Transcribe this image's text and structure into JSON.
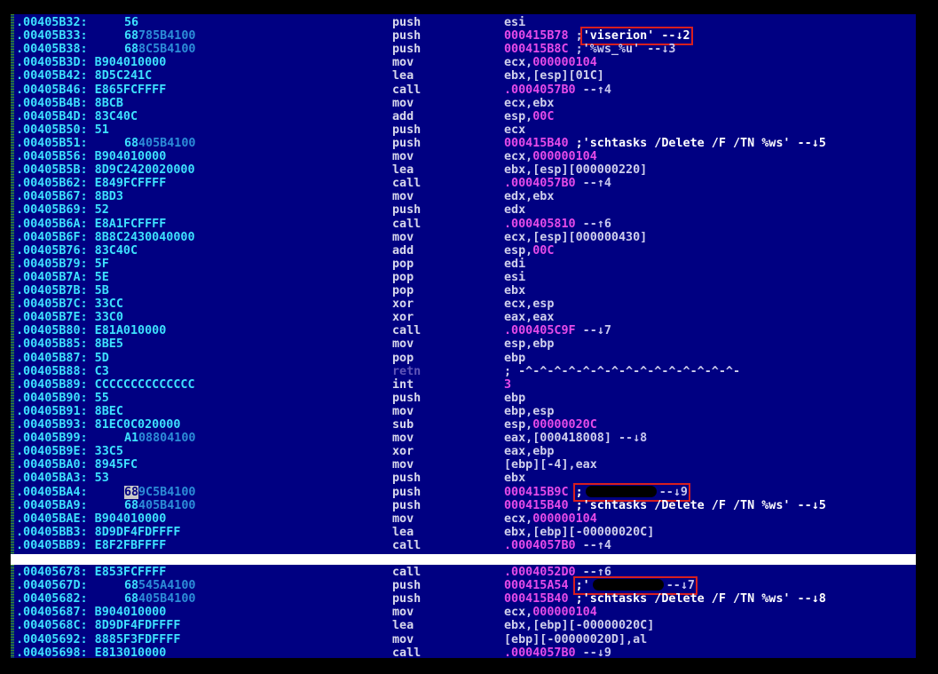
{
  "top_rows": [
    {
      "addr": ".00405B32: 56",
      "b1": "56",
      "b2": "",
      "mn": "push",
      "ops": [
        {
          "t": "esi"
        }
      ]
    },
    {
      "addr": ".00405B33:",
      "b1": "68",
      "b2": "785B4100",
      "mn": "push",
      "ops": [
        {
          "t": "000415B78",
          "c": "imm"
        },
        {
          "t": " ;"
        },
        {
          "t": "'viserion' --↓2",
          "c": "str",
          "hl": true
        }
      ]
    },
    {
      "addr": ".00405B38:",
      "b1": "68",
      "b2": "8C5B4100",
      "mn": "push",
      "ops": [
        {
          "t": "000415B8C",
          "c": "imm"
        },
        {
          "t": " ;'%ws_%u' --↓3",
          "c": "ref"
        }
      ]
    },
    {
      "addr": ".00405B3D: B904010000",
      "b1": "",
      "b2": "",
      "mn": "mov",
      "ops": [
        {
          "t": "ecx,"
        },
        {
          "t": "000000104",
          "c": "imm"
        }
      ]
    },
    {
      "addr": ".00405B42: 8D5C241C",
      "b1": "",
      "b2": "",
      "mn": "lea",
      "ops": [
        {
          "t": "ebx,[esp][01C]",
          "c": "g"
        }
      ]
    },
    {
      "addr": ".00405B46: E865FCFFFF",
      "b1": "",
      "b2": "",
      "mn": "call",
      "ops": [
        {
          "t": ".0004057B0",
          "c": "imm"
        },
        {
          "t": " --↑4",
          "c": "ref"
        }
      ]
    },
    {
      "addr": ".00405B4B: 8BCB",
      "b1": "",
      "b2": "",
      "mn": "mov",
      "ops": [
        {
          "t": "ecx,ebx"
        }
      ]
    },
    {
      "addr": ".00405B4D: 83C40C",
      "b1": "",
      "b2": "",
      "mn": "add",
      "ops": [
        {
          "t": "esp,"
        },
        {
          "t": "00C",
          "c": "imm"
        }
      ]
    },
    {
      "addr": ".00405B50: 51",
      "b1": "",
      "b2": "",
      "mn": "push",
      "ops": [
        {
          "t": "ecx"
        }
      ]
    },
    {
      "addr": ".00405B51:",
      "b1": "68",
      "b2": "405B4100",
      "mn": "push",
      "ops": [
        {
          "t": "000415B40",
          "c": "imm"
        },
        {
          "t": " ;'schtasks /Delete /F /TN %ws' --↓5",
          "c": "str"
        }
      ]
    },
    {
      "addr": ".00405B56: B904010000",
      "b1": "",
      "b2": "",
      "mn": "mov",
      "ops": [
        {
          "t": "ecx,"
        },
        {
          "t": "000000104",
          "c": "imm"
        }
      ]
    },
    {
      "addr": ".00405B5B: 8D9C2420020000",
      "b1": "",
      "b2": "",
      "mn": "lea",
      "ops": [
        {
          "t": "ebx,[esp][000000220]",
          "c": "g"
        }
      ]
    },
    {
      "addr": ".00405B62: E849FCFFFF",
      "b1": "",
      "b2": "",
      "mn": "call",
      "ops": [
        {
          "t": ".0004057B0",
          "c": "imm"
        },
        {
          "t": " --↑4",
          "c": "ref"
        }
      ]
    },
    {
      "addr": ".00405B67: 8BD3",
      "b1": "",
      "b2": "",
      "mn": "mov",
      "ops": [
        {
          "t": "edx,ebx"
        }
      ]
    },
    {
      "addr": ".00405B69: 52",
      "b1": "",
      "b2": "",
      "mn": "push",
      "ops": [
        {
          "t": "edx"
        }
      ]
    },
    {
      "addr": ".00405B6A: E8A1FCFFFF",
      "b1": "",
      "b2": "",
      "mn": "call",
      "ops": [
        {
          "t": ".000405810",
          "c": "imm"
        },
        {
          "t": " --↑6",
          "c": "ref"
        }
      ]
    },
    {
      "addr": ".00405B6F: 8B8C2430040000",
      "b1": "",
      "b2": "",
      "mn": "mov",
      "ops": [
        {
          "t": "ecx,[esp][000000430]",
          "c": "g"
        }
      ]
    },
    {
      "addr": ".00405B76: 83C40C",
      "b1": "",
      "b2": "",
      "mn": "add",
      "ops": [
        {
          "t": "esp,"
        },
        {
          "t": "00C",
          "c": "imm"
        }
      ]
    },
    {
      "addr": ".00405B79: 5F",
      "b1": "",
      "b2": "",
      "mn": "pop",
      "ops": [
        {
          "t": "edi"
        }
      ]
    },
    {
      "addr": ".00405B7A: 5E",
      "b1": "",
      "b2": "",
      "mn": "pop",
      "ops": [
        {
          "t": "esi"
        }
      ]
    },
    {
      "addr": ".00405B7B: 5B",
      "b1": "",
      "b2": "",
      "mn": "pop",
      "ops": [
        {
          "t": "ebx"
        }
      ]
    },
    {
      "addr": ".00405B7C: 33CC",
      "b1": "",
      "b2": "",
      "mn": "xor",
      "ops": [
        {
          "t": "ecx,esp"
        }
      ]
    },
    {
      "addr": ".00405B7E: 33C0",
      "b1": "",
      "b2": "",
      "mn": "xor",
      "ops": [
        {
          "t": "eax,eax"
        }
      ]
    },
    {
      "addr": ".00405B80: E81A010000",
      "b1": "",
      "b2": "",
      "mn": "call",
      "ops": [
        {
          "t": ".000405C9F",
          "c": "imm"
        },
        {
          "t": " --↓7",
          "c": "ref"
        }
      ]
    },
    {
      "addr": ".00405B85: 8BE5",
      "b1": "",
      "b2": "",
      "mn": "mov",
      "ops": [
        {
          "t": "esp,ebp"
        }
      ]
    },
    {
      "addr": ".00405B87: 5D",
      "b1": "",
      "b2": "",
      "mn": "pop",
      "ops": [
        {
          "t": "ebp"
        }
      ]
    },
    {
      "addr": ".00405B88: C3",
      "b1": "",
      "b2": "",
      "mn": "retn",
      "retn": true,
      "ops": [
        {
          "t": "; -^-^-^-^-^-^-^-^-^-^-^-^-^-^-^-",
          "c": "g"
        }
      ]
    },
    {
      "addr": ".00405B89: CCCCCCCCCCCCCC",
      "b1": "",
      "b2": "",
      "mn": "int",
      "ops": [
        {
          "t": "3",
          "c": "imm"
        }
      ]
    },
    {
      "addr": ".00405B90: 55",
      "b1": "",
      "b2": "",
      "mn": "push",
      "ops": [
        {
          "t": "ebp"
        }
      ]
    },
    {
      "addr": ".00405B91: 8BEC",
      "b1": "",
      "b2": "",
      "mn": "mov",
      "ops": [
        {
          "t": "ebp,esp"
        }
      ]
    },
    {
      "addr": ".00405B93: 81EC0C020000",
      "b1": "",
      "b2": "",
      "mn": "sub",
      "ops": [
        {
          "t": "esp,"
        },
        {
          "t": "00000020C",
          "c": "imm"
        }
      ]
    },
    {
      "addr": ".00405B99:",
      "b1": "A1",
      "b2": "08804100",
      "mn": "mov",
      "ops": [
        {
          "t": "eax,[000418008]",
          "c": "g"
        },
        {
          "t": " --↓8",
          "c": "ref"
        }
      ]
    },
    {
      "addr": ".00405B9E: 33C5",
      "b1": "",
      "b2": "",
      "mn": "xor",
      "ops": [
        {
          "t": "eax,ebp"
        }
      ]
    },
    {
      "addr": ".00405BA0: 8945FC",
      "b1": "",
      "b2": "",
      "mn": "mov",
      "ops": [
        {
          "t": "[ebp][-4],eax",
          "c": "g"
        }
      ]
    },
    {
      "addr": ".00405BA3: 53",
      "b1": "",
      "b2": "",
      "mn": "push",
      "ops": [
        {
          "t": "ebx"
        }
      ]
    },
    {
      "addr": ".00405BA4:",
      "b1": "68",
      "b2": "9C5B4100",
      "sel": true,
      "mn": "push",
      "ops": [
        {
          "t": "000415B9C",
          "c": "imm"
        },
        {
          "t": " "
        },
        {
          "t": ";",
          "c": "str",
          "hl": true,
          "redact": true,
          "after": "--↓9"
        }
      ]
    },
    {
      "addr": ".00405BA9:",
      "b1": "68",
      "b2": "405B4100",
      "mn": "push",
      "ops": [
        {
          "t": "000415B40",
          "c": "imm"
        },
        {
          "t": " ;'schtasks /Delete /F /TN %ws' --↓5",
          "c": "str"
        }
      ]
    },
    {
      "addr": ".00405BAE: B904010000",
      "b1": "",
      "b2": "",
      "mn": "mov",
      "ops": [
        {
          "t": "ecx,"
        },
        {
          "t": "000000104",
          "c": "imm"
        }
      ]
    },
    {
      "addr": ".00405BB3: 8D9DF4FDFFFF",
      "b1": "",
      "b2": "",
      "mn": "lea",
      "ops": [
        {
          "t": "ebx,[ebp][-00000020C]",
          "c": "g"
        }
      ]
    },
    {
      "addr": ".00405BB9: E8F2FBFFFF",
      "b1": "",
      "b2": "",
      "mn": "call",
      "ops": [
        {
          "t": ".0004057B0",
          "c": "imm"
        },
        {
          "t": " --↑4",
          "c": "ref"
        }
      ]
    }
  ],
  "bottom_rows": [
    {
      "addr": ".00405678: E853FCFFFF",
      "b1": "",
      "b2": "",
      "mn": "call",
      "ops": [
        {
          "t": ".0004052D0",
          "c": "imm"
        },
        {
          "t": " --↑6",
          "c": "ref"
        }
      ]
    },
    {
      "addr": ".0040567D:",
      "b1": "68",
      "b2": "545A4100",
      "mn": "push",
      "ops": [
        {
          "t": "000415A54",
          "c": "imm"
        },
        {
          "t": " "
        },
        {
          "t": ";'",
          "c": "str",
          "hl": true,
          "redact": true,
          "after": "--↓7"
        }
      ]
    },
    {
      "addr": ".00405682:",
      "b1": "68",
      "b2": "405B4100",
      "mn": "push",
      "ops": [
        {
          "t": "000415B40",
          "c": "imm"
        },
        {
          "t": " ;'schtasks /Delete /F /TN %ws' --↓8",
          "c": "str"
        }
      ]
    },
    {
      "addr": ".00405687: B904010000",
      "b1": "",
      "b2": "",
      "mn": "mov",
      "ops": [
        {
          "t": "ecx,"
        },
        {
          "t": "000000104",
          "c": "imm"
        }
      ]
    },
    {
      "addr": ".0040568C: 8D9DF4FDFFFF",
      "b1": "",
      "b2": "",
      "mn": "lea",
      "ops": [
        {
          "t": "ebx,[ebp][-00000020C]",
          "c": "g"
        }
      ]
    },
    {
      "addr": ".00405692: 8885F3FDFFFF",
      "b1": "",
      "b2": "",
      "mn": "mov",
      "ops": [
        {
          "t": "[ebp][-00000020D],al",
          "c": "g"
        }
      ]
    },
    {
      "addr": ".00405698: E813010000",
      "b1": "",
      "b2": "",
      "mn": "call",
      "ops": [
        {
          "t": ".0004057B0",
          "c": "imm"
        },
        {
          "t": " --↓9",
          "c": "ref"
        }
      ]
    }
  ]
}
